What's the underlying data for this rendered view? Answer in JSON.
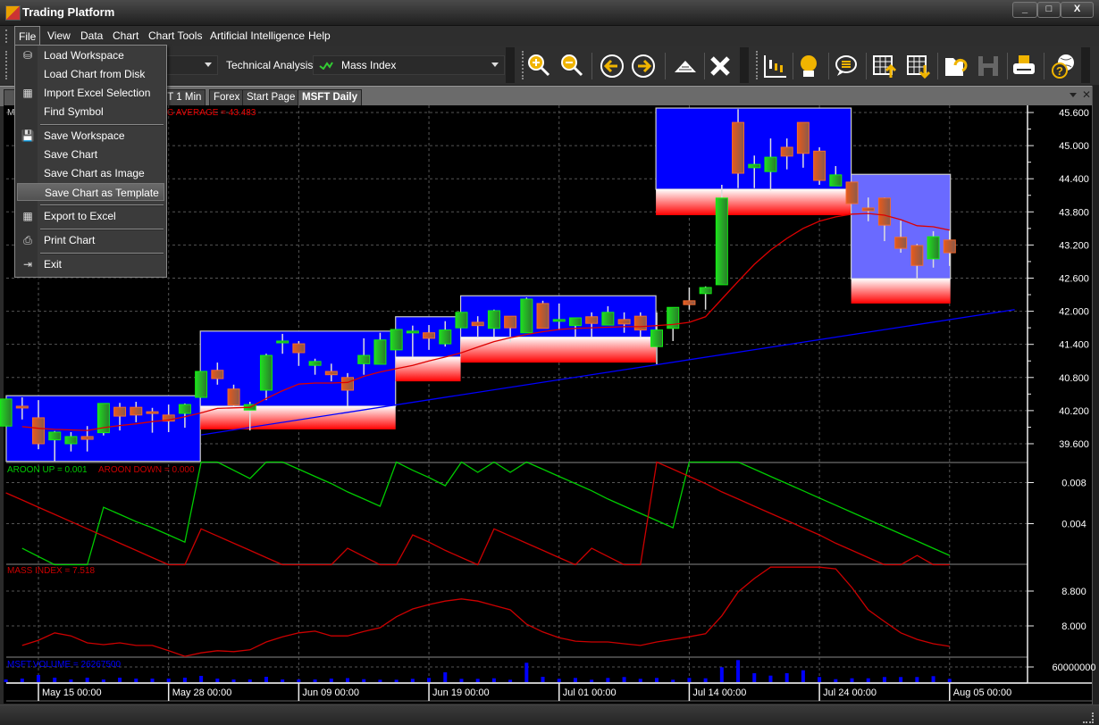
{
  "window": {
    "title": "Trading Platform",
    "minimize": "_",
    "maximize": "□",
    "close": "X"
  },
  "menubar": [
    "File",
    "View",
    "Data",
    "Chart",
    "Chart Tools",
    "Artificial Intelligence",
    "Help"
  ],
  "toolbar": {
    "technical_analysis_label": "Technical Analysis",
    "indicator_combo_value": "Mass Index",
    "icons": [
      "zoom-in-icon",
      "zoom-out-icon",
      "arrow-left-icon",
      "arrow-right-icon",
      "pyramid-icon",
      "close-x-icon",
      "candlestick-chart-icon",
      "alarm-bell-icon",
      "speech-bubble-icon",
      "grid-import-icon",
      "grid-export-icon",
      "open-folder-icon",
      "save-disk-icon",
      "printer-icon",
      "help-globe-icon"
    ]
  },
  "tabs": [
    {
      "label": "MSFT 1 Min",
      "active": false
    },
    {
      "label": "Forex",
      "active": false
    },
    {
      "label": "Start Page",
      "active": false
    },
    {
      "label": "MSFT Daily",
      "active": true
    }
  ],
  "file_menu": {
    "items": [
      {
        "label": "Load Workspace",
        "icon": "load-workspace-icon"
      },
      {
        "label": "Load Chart from Disk",
        "icon": ""
      },
      {
        "label": "Import Excel Selection",
        "icon": "import-excel-icon"
      },
      {
        "label": "Find Symbol",
        "icon": ""
      },
      {
        "separator": true
      },
      {
        "label": "Save Workspace",
        "icon": "save-icon"
      },
      {
        "label": "Save Chart",
        "icon": ""
      },
      {
        "label": "Save Chart as Image",
        "icon": ""
      },
      {
        "label": "Save Chart as Template",
        "icon": "",
        "highlighted": true
      },
      {
        "separator": true
      },
      {
        "label": "Export to Excel",
        "icon": "export-excel-icon"
      },
      {
        "separator": true
      },
      {
        "label": "Print Chart",
        "icon": "print-icon"
      },
      {
        "separator": true
      },
      {
        "label": "Exit",
        "icon": "exit-icon"
      }
    ]
  },
  "colors": {
    "up": "#22cc22",
    "down": "#d2561e",
    "ma": "#dd0000",
    "trend": "#0000ff",
    "zone": "#0000ff",
    "zone_light": "#6a6aff",
    "aroon_up": "#00cc00",
    "aroon_down": "#cc0000",
    "mass": "#cc0000",
    "volume": "#0000ff"
  },
  "chart_data": [
    {
      "type": "candlestick",
      "labels": {
        "prefix": "M",
        "moving_average": "MOVING AVERAGE = 43.483"
      },
      "x_tick_labels": [
        {
          "index": 2,
          "label": "May 15 00:00"
        },
        {
          "index": 10,
          "label": "May 28 00:00"
        },
        {
          "index": 18,
          "label": "Jun 09 00:00"
        },
        {
          "index": 26,
          "label": "Jun 19 00:00"
        },
        {
          "index": 34,
          "label": "Jul 01 00:00"
        },
        {
          "index": 42,
          "label": "Jul 14 00:00"
        },
        {
          "index": 50,
          "label": "Jul 24 00:00"
        },
        {
          "index": 58,
          "label": "Aug 05 00:00"
        }
      ],
      "y_ticks": [
        "39.600",
        "40.200",
        "40.800",
        "41.400",
        "42.000",
        "42.600",
        "43.200",
        "43.800",
        "44.400",
        "45.000",
        "45.600"
      ],
      "ylim": [
        39.6,
        45.6
      ],
      "grid": true,
      "ohlc": [
        [
          39.92,
          40.41,
          39.92,
          40.41
        ],
        [
          40.28,
          40.44,
          40.04,
          40.25
        ],
        [
          40.07,
          40.39,
          39.5,
          39.6
        ],
        [
          39.67,
          39.83,
          39.28,
          39.81
        ],
        [
          39.6,
          39.81,
          39.46,
          39.73
        ],
        [
          39.73,
          39.92,
          39.46,
          39.68
        ],
        [
          39.8,
          40.33,
          39.75,
          40.33
        ],
        [
          40.26,
          40.34,
          39.84,
          40.1
        ],
        [
          40.26,
          40.36,
          39.99,
          40.12
        ],
        [
          40.18,
          40.25,
          39.8,
          40.15
        ],
        [
          40.12,
          40.31,
          39.81,
          40.01
        ],
        [
          40.15,
          40.33,
          39.89,
          40.31
        ],
        [
          40.44,
          40.91,
          40.44,
          40.91
        ],
        [
          40.93,
          41.07,
          40.67,
          40.78
        ],
        [
          40.59,
          40.67,
          40.28,
          40.3
        ],
        [
          40.21,
          40.36,
          39.84,
          40.31
        ],
        [
          40.57,
          41.23,
          40.39,
          41.2
        ],
        [
          41.43,
          41.59,
          41.23,
          41.46
        ],
        [
          41.41,
          41.46,
          41.01,
          41.25
        ],
        [
          41.02,
          41.14,
          40.85,
          41.09
        ],
        [
          40.91,
          41.05,
          40.73,
          40.85
        ],
        [
          40.8,
          40.88,
          40.28,
          40.57
        ],
        [
          41.05,
          41.51,
          40.85,
          41.2
        ],
        [
          41.04,
          41.61,
          41.04,
          41.48
        ],
        [
          41.3,
          41.67,
          41.3,
          41.67
        ],
        [
          41.61,
          41.74,
          41.17,
          41.64
        ],
        [
          41.61,
          41.75,
          41.3,
          41.51
        ],
        [
          41.41,
          41.82,
          41.36,
          41.66
        ],
        [
          41.7,
          41.98,
          41.7,
          41.98
        ],
        [
          41.8,
          41.91,
          41.54,
          41.74
        ],
        [
          41.69,
          42.03,
          41.53,
          42.01
        ],
        [
          41.91,
          41.91,
          41.44,
          41.7
        ],
        [
          41.61,
          42.25,
          41.61,
          42.22
        ],
        [
          42.14,
          42.19,
          41.69,
          41.69
        ],
        [
          41.82,
          42.14,
          41.66,
          41.85
        ],
        [
          41.74,
          41.88,
          41.53,
          41.88
        ],
        [
          41.9,
          41.98,
          41.53,
          41.78
        ],
        [
          41.75,
          42.09,
          41.75,
          41.98
        ],
        [
          41.85,
          41.98,
          41.61,
          41.77
        ],
        [
          41.91,
          41.98,
          41.53,
          41.66
        ],
        [
          41.36,
          41.98,
          41.04,
          41.66
        ],
        [
          41.69,
          42.07,
          41.46,
          42.07
        ],
        [
          42.19,
          42.43,
          42.03,
          42.12
        ],
        [
          42.32,
          42.45,
          42.03,
          42.43
        ],
        [
          42.48,
          44.29,
          42.48,
          44.05
        ],
        [
          45.42,
          45.66,
          44.23,
          44.5
        ],
        [
          44.6,
          44.82,
          44.23,
          44.66
        ],
        [
          44.53,
          45.13,
          44.19,
          44.79
        ],
        [
          44.97,
          45.13,
          44.57,
          44.81
        ],
        [
          45.42,
          45.42,
          44.6,
          44.86
        ],
        [
          44.9,
          44.97,
          44.29,
          44.37
        ],
        [
          44.27,
          44.63,
          44.27,
          44.47
        ],
        [
          44.34,
          44.34,
          43.95,
          43.95
        ],
        [
          43.87,
          44.06,
          43.63,
          43.82
        ],
        [
          44.05,
          44.06,
          43.27,
          43.56
        ],
        [
          43.34,
          43.64,
          43.06,
          43.14
        ],
        [
          43.19,
          43.22,
          42.58,
          42.83
        ],
        [
          42.95,
          43.45,
          42.79,
          43.35
        ],
        [
          43.29,
          43.47,
          42.82,
          43.06
        ]
      ],
      "moving_average": [
        null,
        39.91,
        39.88,
        39.86,
        39.85,
        39.84,
        39.89,
        39.93,
        39.96,
        40.0,
        40.03,
        40.09,
        40.16,
        40.24,
        40.25,
        40.26,
        40.42,
        40.56,
        40.68,
        40.7,
        40.7,
        40.71,
        40.82,
        40.9,
        40.96,
        41.02,
        41.1,
        41.17,
        41.25,
        41.35,
        41.45,
        41.52,
        41.58,
        41.63,
        41.67,
        41.69,
        41.7,
        41.71,
        41.72,
        41.72,
        41.74,
        41.76,
        41.8,
        41.9,
        42.22,
        42.54,
        42.85,
        43.11,
        43.32,
        43.5,
        43.63,
        43.71,
        43.76,
        43.77,
        43.74,
        43.66,
        43.55,
        43.53,
        43.47
      ],
      "trend_line": {
        "from": [
          12,
          39.76
        ],
        "to": [
          62,
          42.03
        ]
      },
      "zones": [
        {
          "start": 0,
          "end": 11.95,
          "top": 40.47,
          "bottom": 39.28,
          "support": null,
          "light": false
        },
        {
          "start": 11.95,
          "end": 23.95,
          "top": 41.64,
          "bottom": 40.28,
          "support": 39.86,
          "light": false
        },
        {
          "start": 23.95,
          "end": 27.95,
          "top": 41.9,
          "bottom": 41.17,
          "support": 40.73,
          "light": false
        },
        {
          "start": 27.95,
          "end": 39.95,
          "top": 42.28,
          "bottom": 41.53,
          "support": 41.07,
          "light": false
        },
        {
          "start": 39.95,
          "end": 51.95,
          "top": 45.68,
          "bottom": 44.21,
          "support": 43.74,
          "light": false
        },
        {
          "start": 51.95,
          "end": 58.05,
          "top": 44.48,
          "bottom": 42.59,
          "support": 42.14,
          "light": true
        }
      ]
    },
    {
      "type": "line",
      "legend": [
        "AROON UP = 0.001",
        "AROON DOWN = 0.000"
      ],
      "y_ticks": [
        "0.008",
        "0.004"
      ],
      "ylim": [
        0,
        0.01
      ],
      "series": [
        {
          "name": "AROON UP",
          "values": [
            null,
            0.0016,
            0.0008,
            0,
            0,
            0,
            0.0056,
            0.0049,
            0.0042,
            0.0036,
            0.0029,
            0.0022,
            0.01,
            0.01,
            0.0092,
            0.0084,
            0.01,
            0.01,
            0.0093,
            0.0086,
            0.0079,
            0.0071,
            0.0064,
            0.0057,
            0.01,
            0.0092,
            0.0085,
            0.0077,
            0.01,
            0.009,
            0.01,
            0.009,
            0.01,
            0.0093,
            0.0086,
            0.0079,
            0.0072,
            0.0064,
            0.0057,
            0.005,
            0.0043,
            0.0036,
            0.01,
            0.01,
            0.01,
            0.01,
            0.0093,
            0.0086,
            0.0079,
            0.0072,
            0.0065,
            0.0058,
            0.0051,
            0.0044,
            0.0037,
            0.003,
            0.0023,
            0.0016,
            0.0009
          ]
        },
        {
          "name": "AROON DOWN",
          "values": [
            0.007,
            0.0063,
            0.0056,
            0.0049,
            0.0042,
            0.0035,
            0.0028,
            0.0021,
            0.0014,
            0.0007,
            0,
            0,
            0.0035,
            0.0028,
            0.0021,
            0.0014,
            0.0007,
            0,
            0,
            0,
            0,
            0.0016,
            0.0008,
            0,
            0,
            0.0029,
            0.0022,
            0.0014,
            0.0007,
            0,
            0.0035,
            0.0028,
            0.0021,
            0.0014,
            0.0007,
            0,
            0.0016,
            0.0008,
            0,
            0,
            0.01,
            0.0093,
            0.0086,
            0.0079,
            0.0071,
            0.0064,
            0.0057,
            0.005,
            0.0043,
            0.0036,
            0.0029,
            0.0021,
            0.0014,
            0.0007,
            0,
            0,
            0.0009,
            0,
            0
          ]
        }
      ]
    },
    {
      "type": "line",
      "legend": [
        "MASS INDEX = 7.518"
      ],
      "y_ticks": [
        "8.800",
        "8.000"
      ],
      "ylim": [
        7.3,
        9.4
      ],
      "series": [
        {
          "name": "MASS INDEX",
          "values": [
            null,
            7.55,
            7.67,
            7.84,
            7.77,
            7.61,
            7.57,
            7.61,
            7.55,
            7.55,
            7.43,
            7.3,
            7.38,
            7.43,
            7.41,
            7.45,
            7.63,
            7.75,
            7.84,
            7.88,
            7.77,
            7.77,
            7.87,
            7.96,
            8.21,
            8.39,
            8.49,
            8.57,
            8.62,
            8.57,
            8.47,
            8.37,
            8.04,
            7.86,
            7.73,
            7.65,
            7.63,
            7.63,
            7.59,
            7.55,
            7.63,
            7.69,
            7.75,
            7.82,
            8.23,
            8.78,
            9.09,
            9.35,
            9.35,
            9.35,
            9.35,
            9.31,
            8.88,
            8.37,
            8.1,
            7.84,
            7.69,
            7.59,
            7.53
          ]
        }
      ]
    },
    {
      "type": "bar",
      "legend": [
        "MSFT.VOLUME = 26267500"
      ],
      "y_ticks": [
        "60000000"
      ],
      "ylim": [
        16900000,
        85000000
      ],
      "series": [
        {
          "name": "MSFT.VOLUME",
          "values": [
            24500000,
            27000000,
            37200000,
            29600000,
            24500000,
            29600000,
            24500000,
            29600000,
            27000000,
            27000000,
            27000000,
            29600000,
            34700000,
            27000000,
            24500000,
            24500000,
            32100000,
            24500000,
            24500000,
            24500000,
            27000000,
            28300000,
            25300000,
            23700000,
            23700000,
            26300000,
            28800000,
            44800000,
            26300000,
            26300000,
            27800000,
            23700000,
            71900000,
            32100000,
            26300000,
            28800000,
            23700000,
            28800000,
            31400000,
            26300000,
            28800000,
            23700000,
            28800000,
            27800000,
            59300000,
            79500000,
            42300000,
            35400000,
            42300000,
            50600000,
            31400000,
            25300000,
            27800000,
            27800000,
            31400000,
            31400000,
            31400000,
            33900000,
            26267500
          ]
        }
      ]
    }
  ]
}
